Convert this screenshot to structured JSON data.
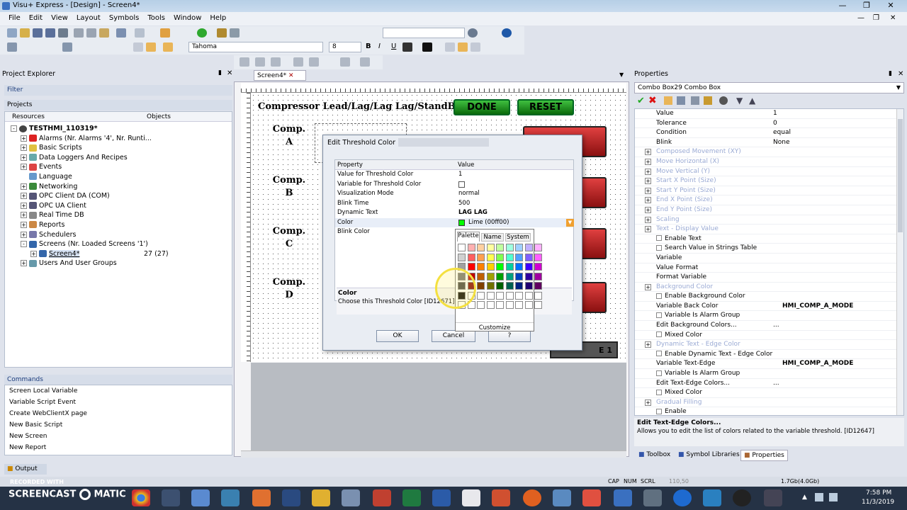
{
  "window": {
    "title": "Visu+ Express - [Design] - Screen4*"
  },
  "menu": [
    "File",
    "Edit",
    "View",
    "Layout",
    "Symbols",
    "Tools",
    "Window",
    "Help"
  ],
  "format_bar": {
    "font": "Tahoma",
    "size": "8",
    "bold": "B",
    "italic": "I",
    "underline": "U"
  },
  "project_explorer": {
    "title": "Project Explorer",
    "filter": "Filter",
    "projects": "Projects",
    "col_resources": "Resources",
    "col_objects": "Objects",
    "items": [
      {
        "label": "TESTHMI_110319*",
        "objects": ""
      },
      {
        "label": "Alarms (Nr. Alarms '4', Nr. Runti...",
        "objects": ""
      },
      {
        "label": "Basic Scripts",
        "objects": ""
      },
      {
        "label": "Data Loggers And Recipes",
        "objects": ""
      },
      {
        "label": "Events",
        "objects": ""
      },
      {
        "label": "Language",
        "objects": ""
      },
      {
        "label": "Networking",
        "objects": ""
      },
      {
        "label": "OPC Client DA (COM)",
        "objects": ""
      },
      {
        "label": "OPC UA Client",
        "objects": ""
      },
      {
        "label": "Real Time DB",
        "objects": ""
      },
      {
        "label": "Reports",
        "objects": ""
      },
      {
        "label": "Schedulers",
        "objects": ""
      },
      {
        "label": "Screens (Nr. Loaded Screens '1')",
        "objects": ""
      },
      {
        "label": "Screen4*",
        "objects": "27 (27)"
      },
      {
        "label": "Users And User Groups",
        "objects": ""
      }
    ]
  },
  "commands": {
    "title": "Commands",
    "items": [
      "Screen Local Variable",
      "Variable Script Event",
      "Create WebClientX page",
      "New Basic Script",
      "New Screen",
      "New Report"
    ]
  },
  "output_tab": "Output",
  "screen_tab": "Screen4*",
  "screen": {
    "title": "Compressor Lead/Lag/Lag Lag/StandBy",
    "done": "DONE",
    "reset": "RESET",
    "comps": [
      {
        "a": "Comp.",
        "b": "A"
      },
      {
        "a": "Comp.",
        "b": "B"
      },
      {
        "a": "Comp.",
        "b": "C"
      },
      {
        "a": "Comp.",
        "b": "D"
      }
    ],
    "bottom_label": "E 1"
  },
  "dialog": {
    "title": "Edit Threshold Color",
    "col_property": "Property",
    "col_value": "Value",
    "rows": [
      {
        "k": "Value for Threshold Color",
        "v": "1"
      },
      {
        "k": "Variable for Threshold Color",
        "v": ""
      },
      {
        "k": "Visualization Mode",
        "v": "normal"
      },
      {
        "k": "Blink Time",
        "v": "500"
      },
      {
        "k": "Dynamic Text",
        "v": "LAG LAG"
      },
      {
        "k": "Color",
        "v": "Lime (00ff00)"
      },
      {
        "k": "Blink Color",
        "v": ""
      }
    ],
    "desc_title": "Color",
    "desc_text": "Choose this Threshold Color [ID12671]",
    "ok": "OK",
    "cancel": "Cancel",
    "help": "?",
    "palette_tabs": [
      "Palette",
      "Name",
      "System"
    ],
    "customize": "Customize"
  },
  "properties": {
    "title": "Properties",
    "object": "Combo Box29 Combo Box",
    "rows": [
      {
        "t": "kv",
        "k": "Value",
        "v": "1"
      },
      {
        "t": "kv",
        "k": "Tolerance",
        "v": "0"
      },
      {
        "t": "kv",
        "k": "Condition",
        "v": "equal"
      },
      {
        "t": "kv",
        "k": "Blink",
        "v": "None"
      },
      {
        "t": "cat",
        "k": "Composed Movement (XY)"
      },
      {
        "t": "cat",
        "k": "Move Horizontal (X)"
      },
      {
        "t": "cat",
        "k": "Move Vertical (Y)"
      },
      {
        "t": "cat",
        "k": "Start X Point (Size)"
      },
      {
        "t": "cat",
        "k": "Start Y Point (Size)"
      },
      {
        "t": "cat",
        "k": "End X Point (Size)"
      },
      {
        "t": "cat",
        "k": "End Y Point (Size)"
      },
      {
        "t": "cat",
        "k": "Scaling"
      },
      {
        "t": "cat",
        "k": "Text - Display Value"
      },
      {
        "t": "chk",
        "k": "Enable Text",
        "v": ""
      },
      {
        "t": "chk",
        "k": "Search Value in Strings Table",
        "v": ""
      },
      {
        "t": "kv",
        "k": "Variable",
        "v": ""
      },
      {
        "t": "kv",
        "k": "Value Format",
        "v": ""
      },
      {
        "t": "kv",
        "k": "Format Variable",
        "v": ""
      },
      {
        "t": "cat",
        "k": "Background Color"
      },
      {
        "t": "chk",
        "k": "Enable Background Color",
        "v": ""
      },
      {
        "t": "kv",
        "k": "Variable Back Color",
        "v": "HMI_COMP_A_MODE"
      },
      {
        "t": "chk",
        "k": "Variable Is Alarm Group",
        "v": ""
      },
      {
        "t": "kv",
        "k": "Edit Background Colors...",
        "v": "..."
      },
      {
        "t": "chk",
        "k": "Mixed Color",
        "v": ""
      },
      {
        "t": "cat",
        "k": "Dynamic Text - Edge Color"
      },
      {
        "t": "chk",
        "k": "Enable Dynamic Text - Edge Color",
        "v": ""
      },
      {
        "t": "kv",
        "k": "Variable Text-Edge",
        "v": "HMI_COMP_A_MODE"
      },
      {
        "t": "chk",
        "k": "Variable Is Alarm Group",
        "v": ""
      },
      {
        "t": "kv",
        "k": "Edit Text-Edge Colors...",
        "v": "..."
      },
      {
        "t": "chk",
        "k": "Mixed Color",
        "v": ""
      },
      {
        "t": "cat",
        "k": "Gradual Filling"
      },
      {
        "t": "chk",
        "k": "Enable",
        "v": ""
      }
    ],
    "help_title": "Edit Text-Edge Colors...",
    "help_text": "Allows you to edit the list of colors related to the variable threshold. [ID12647]",
    "tabs": [
      "Toolbox",
      "Symbol Libraries",
      "Properties"
    ]
  },
  "statusbar": {
    "cap": "CAP",
    "num": "NUM",
    "scrl": "SCRL",
    "coords": "110,50",
    "memory": "1.7Gb(4.0Gb)"
  },
  "taskbar": {
    "time": "7:58 PM",
    "date": "11/3/2019",
    "watermark_top": "RECORDED WITH",
    "watermark": "SCREENCAST",
    "watermark2": "MATIC"
  }
}
